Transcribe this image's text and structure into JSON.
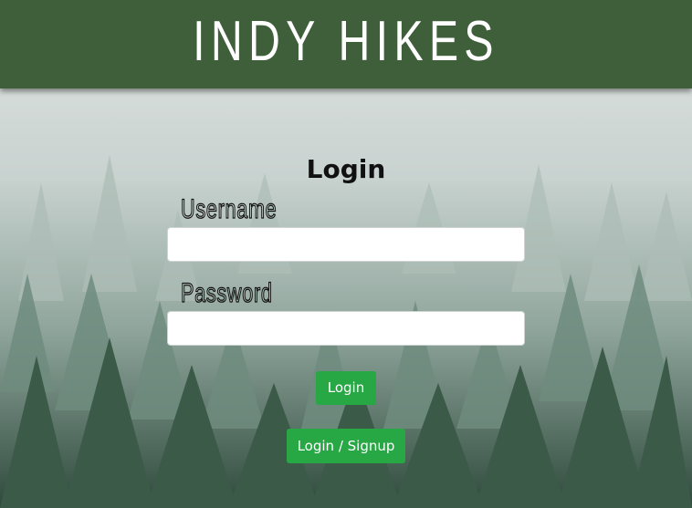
{
  "header": {
    "brand": "INDY HIKES",
    "color": "#3f5f3b"
  },
  "form": {
    "title": "Login",
    "username_label": "Username",
    "username_value": "",
    "password_label": "Password",
    "password_value": "",
    "login_button": "Login",
    "signup_button": "Login / Signup",
    "button_color": "#28a745"
  }
}
